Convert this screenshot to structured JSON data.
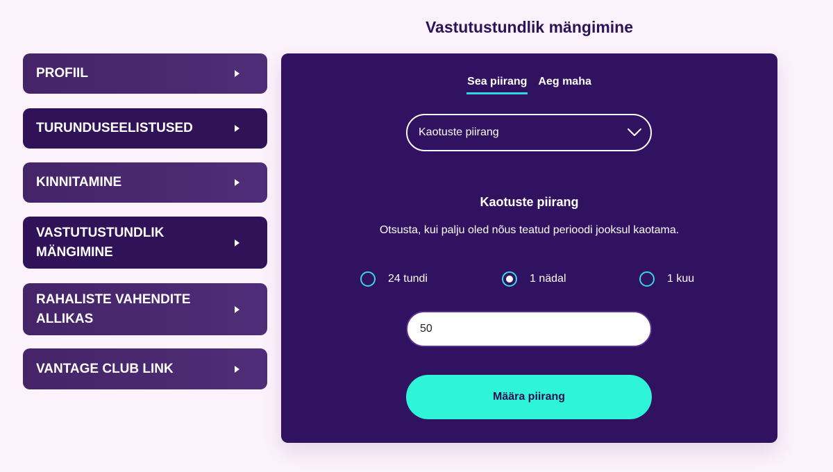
{
  "page_title": "Vastutustundlik mängimine",
  "sidebar": {
    "items": [
      {
        "label": "PROFIIL"
      },
      {
        "label": "TURUNDUSEELISTUSED"
      },
      {
        "label": "KINNITAMINE"
      },
      {
        "label": "VASTUTUSTUNDLIK\nMÄNGIMINE"
      },
      {
        "label": "RAHALISTE VAHENDITE\nALLIKAS"
      },
      {
        "label": "VANTAGE CLUB LINK"
      }
    ]
  },
  "tabs": [
    {
      "label": "Sea piirang",
      "active": true
    },
    {
      "label": "Aeg maha",
      "active": false
    }
  ],
  "limit_select": {
    "value": "Kaotuste piirang"
  },
  "section": {
    "title": "Kaotuste piirang",
    "description": "Otsusta, kui palju oled nõus teatud perioodi jooksul kaotama."
  },
  "period_options": [
    {
      "label": "24 tundi",
      "selected": false
    },
    {
      "label": "1 nädal",
      "selected": true
    },
    {
      "label": "1 kuu",
      "selected": false
    }
  ],
  "amount_input": {
    "value": "50"
  },
  "submit_label": "Määra piirang",
  "colors": {
    "background": "#fcf2fc",
    "panel": "#311260",
    "accent": "#2ef4d8",
    "radio": "#3ad7e2",
    "title": "#2c1258"
  }
}
